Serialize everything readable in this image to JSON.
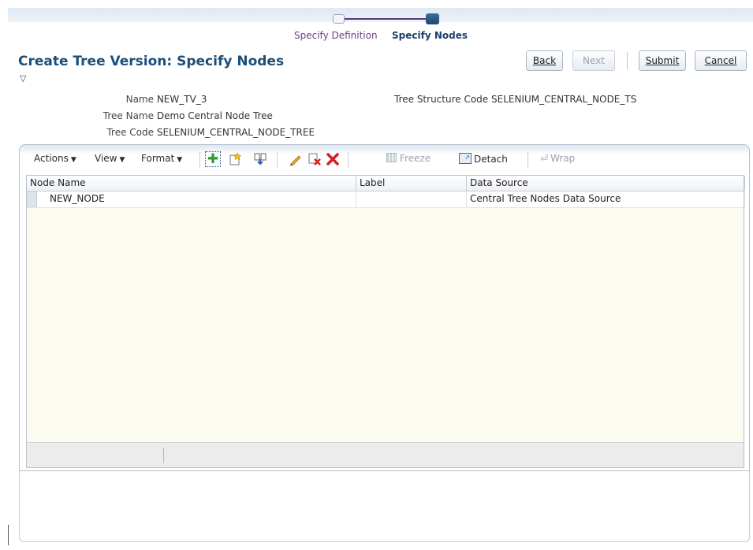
{
  "train": {
    "steps": [
      {
        "label": "Specify Definition",
        "state": "visited"
      },
      {
        "label": "Specify Nodes",
        "state": "current"
      }
    ]
  },
  "page": {
    "title": "Create Tree Version: Specify Nodes",
    "disclosure_glyph": "▽"
  },
  "buttons": {
    "back": "Back",
    "next": "Next",
    "submit": "Submit",
    "cancel": "Cancel"
  },
  "fields": {
    "name_label": "Name",
    "name_value": "NEW_TV_3",
    "tree_name_label": "Tree Name",
    "tree_name_value": "Demo Central Node Tree",
    "tree_code_label": "Tree Code",
    "tree_code_value": "SELENIUM_CENTRAL_NODE_TREE",
    "tree_structure_code_label": "Tree Structure Code",
    "tree_structure_code_value": "SELENIUM_CENTRAL_NODE_TS"
  },
  "toolbar": {
    "actions": "Actions",
    "view": "View",
    "format": "Format",
    "freeze": "Freeze",
    "detach": "Detach",
    "wrap": "Wrap",
    "icons": [
      "add-icon",
      "create-child-icon",
      "import-icon",
      "edit-icon",
      "remove-icon",
      "delete-icon"
    ]
  },
  "table": {
    "columns": [
      "Node Name",
      "Label",
      "Data Source"
    ],
    "rows": [
      {
        "node_name": "NEW_NODE",
        "label": "",
        "data_source": "Central Tree Nodes Data Source"
      }
    ]
  },
  "colors": {
    "title": "#1b4f7a",
    "train_visited": "#6e3e8a",
    "train_current": "#1e3f6a",
    "add_icon": "#2fa02f",
    "delete_icon": "#d42020",
    "grid_bg": "#fbfbef"
  }
}
